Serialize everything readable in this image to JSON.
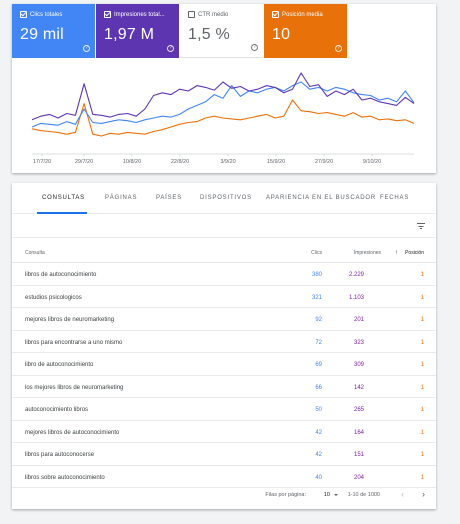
{
  "metrics": [
    {
      "label": "Clics totales",
      "value": "29 mil",
      "checked": true
    },
    {
      "label": "Impresiones total...",
      "value": "1,97 M",
      "checked": true
    },
    {
      "label": "CTR medio",
      "value": "1,5 %",
      "checked": false
    },
    {
      "label": "Posición media",
      "value": "10",
      "checked": true
    }
  ],
  "chart_data": {
    "type": "line",
    "x_ticks": [
      "17/7/20",
      "29/7/20",
      "10/8/20",
      "22/8/20",
      "3/9/20",
      "15/9/20",
      "27/9/20",
      "9/10/20"
    ],
    "series": [
      {
        "color": "#5e35b1",
        "values": [
          38,
          42,
          44,
          40,
          45,
          43,
          78,
          44,
          43,
          41,
          44,
          45,
          42,
          50,
          65,
          68,
          66,
          72,
          70,
          76,
          74,
          71,
          80,
          73,
          75,
          70,
          72,
          76,
          74,
          68,
          72,
          90,
          75,
          77,
          64,
          70,
          66,
          72,
          60,
          62,
          58,
          56,
          54,
          63,
          56
        ]
      },
      {
        "color": "#4285f4",
        "values": [
          30,
          34,
          33,
          32,
          36,
          33,
          50,
          35,
          34,
          36,
          38,
          37,
          35,
          38,
          40,
          42,
          41,
          44,
          50,
          54,
          58,
          66,
          62,
          76,
          64,
          70,
          68,
          72,
          74,
          70,
          76,
          80,
          72,
          74,
          70,
          74,
          72,
          68,
          66,
          65,
          60,
          62,
          58,
          70,
          57
        ]
      },
      {
        "color": "#e8710a",
        "values": [
          28,
          26,
          25,
          24,
          22,
          24,
          56,
          22,
          20,
          23,
          22,
          24,
          23,
          22,
          25,
          27,
          30,
          33,
          35,
          36,
          40,
          42,
          40,
          39,
          38,
          40,
          42,
          44,
          40,
          42,
          60,
          48,
          47,
          45,
          46,
          44,
          42,
          46,
          41,
          42,
          38,
          39,
          37,
          38,
          34
        ]
      }
    ]
  },
  "tabs": [
    "CONSULTAS",
    "PÁGINAS",
    "PAÍSES",
    "DISPOSITIVOS",
    "APARIENCIA EN EL BUSCADOR",
    "FECHAS"
  ],
  "table": {
    "headers": {
      "query": "Consulta",
      "clicks": "Clics",
      "impressions": "Impresiones",
      "position": "Posición"
    },
    "sort_arrow": "↑",
    "rows": [
      {
        "query": "libros de autoconocimiento",
        "clicks": "380",
        "impressions": "2.229",
        "position": "1"
      },
      {
        "query": "estudios psicologicos",
        "clicks": "321",
        "impressions": "1.103",
        "position": "1"
      },
      {
        "query": "mejores libros de neuromarketing",
        "clicks": "92",
        "impressions": "201",
        "position": "1"
      },
      {
        "query": "libros para encontrarse a uno mismo",
        "clicks": "72",
        "impressions": "323",
        "position": "1"
      },
      {
        "query": "libro de autoconocimiento",
        "clicks": "69",
        "impressions": "309",
        "position": "1"
      },
      {
        "query": "los mejores libros de neuromarketing",
        "clicks": "66",
        "impressions": "142",
        "position": "1"
      },
      {
        "query": "autoconocimiento libros",
        "clicks": "50",
        "impressions": "265",
        "position": "1"
      },
      {
        "query": "mejores libros de autoconocimiento",
        "clicks": "42",
        "impressions": "164",
        "position": "1"
      },
      {
        "query": "libros para autoconocerse",
        "clicks": "42",
        "impressions": "151",
        "position": "1"
      },
      {
        "query": "libros sobre autoconocimiento",
        "clicks": "40",
        "impressions": "204",
        "position": "1"
      }
    ]
  },
  "pager": {
    "rows_label": "Filas por página:",
    "rows_value": "10",
    "range": "1-10 de 1000",
    "prev": "‹",
    "next": "›"
  }
}
